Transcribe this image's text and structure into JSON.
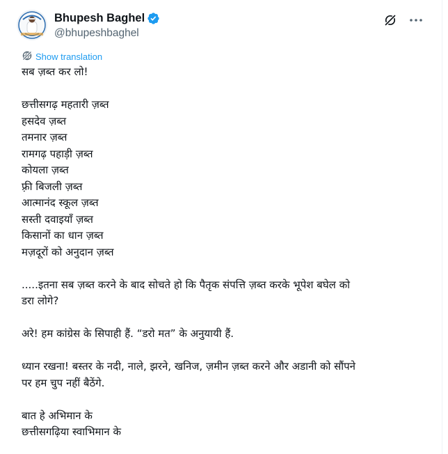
{
  "post": {
    "author": {
      "name": "Bhupesh Baghel",
      "handle": "@bhupeshbaghel",
      "verified": true
    },
    "icons": {
      "verified": "verified-badge-icon",
      "grok": "grok-icon",
      "more": "more-options-icon",
      "translate": "globe-translate-icon"
    },
    "show_translation": "Show translation",
    "lines": [
      "सब ज़ब्त कर लो!",
      "",
      "छत्तीसगढ़ महतारी ज़ब्त",
      "हसदेव ज़ब्त",
      "तमनार ज़ब्त",
      "रामगढ़ पहाड़ी ज़ब्त",
      "कोयला ज़ब्त",
      "फ़्री बिजली ज़ब्त",
      "आत्मानंद स्कूल ज़ब्त",
      "सस्ती दवाइयाँ ज़ब्त",
      "किसानों का धान ज़ब्त",
      "मज़दूरों को अनुदान ज़ब्त",
      "",
      ".....इतना सब ज़ब्त करने के बाद सोचते हो कि पैतृक संपत्ति ज़ब्त करके भूपेश बघेल को",
      "डरा लोगे?",
      "",
      "अरे! हम कांग्रेस के सिपाही हैं. “डरो मत” के अनुयायी हैं.",
      "",
      "ध्यान रखना! बस्तर के नदी, नाले, झरने, खनिज, ज़मीन ज़ब्त करने और अडानी को सौंपने",
      "पर हम चुप नहीं बैठेंगे.",
      "",
      "बात हे अभिमान के",
      "छत्तीसगढ़िया स्वाभिमान के"
    ]
  },
  "colors": {
    "text": "#0f1419",
    "secondary": "#536471",
    "accent": "#1d9bf0",
    "verified": "#1d9bf0"
  }
}
